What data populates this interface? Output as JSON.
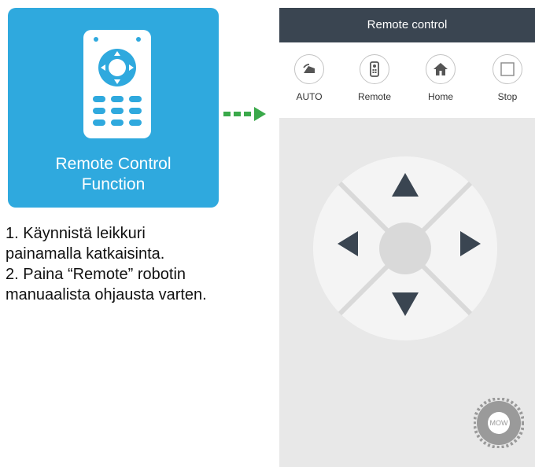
{
  "feature_card": {
    "title_line1": "Remote Control",
    "title_line2": "Function",
    "icon": "remote-control-icon",
    "color": "#2fa9de"
  },
  "arrow": {
    "icon": "dashed-arrow-right-icon",
    "color": "#3aa94a"
  },
  "instructions": {
    "line1": "1. Käynnistä leikkuri",
    "line2": "painamalla katkaisinta.",
    "line3": "2. Paina “Remote” robotin",
    "line4": "manuaalista ohjausta varten."
  },
  "app": {
    "header_title": "Remote control",
    "header_color": "#3a4551",
    "toolbar": [
      {
        "label": "AUTO",
        "icon": "auto-mow-icon"
      },
      {
        "label": "Remote",
        "icon": "remote-icon"
      },
      {
        "label": "Home",
        "icon": "home-icon"
      },
      {
        "label": "Stop",
        "icon": "stop-icon"
      }
    ],
    "dpad": {
      "up_icon": "arrow-up-icon",
      "down_icon": "arrow-down-icon",
      "left_icon": "arrow-left-icon",
      "right_icon": "arrow-right-icon"
    },
    "mow_button_label": "MOW"
  }
}
